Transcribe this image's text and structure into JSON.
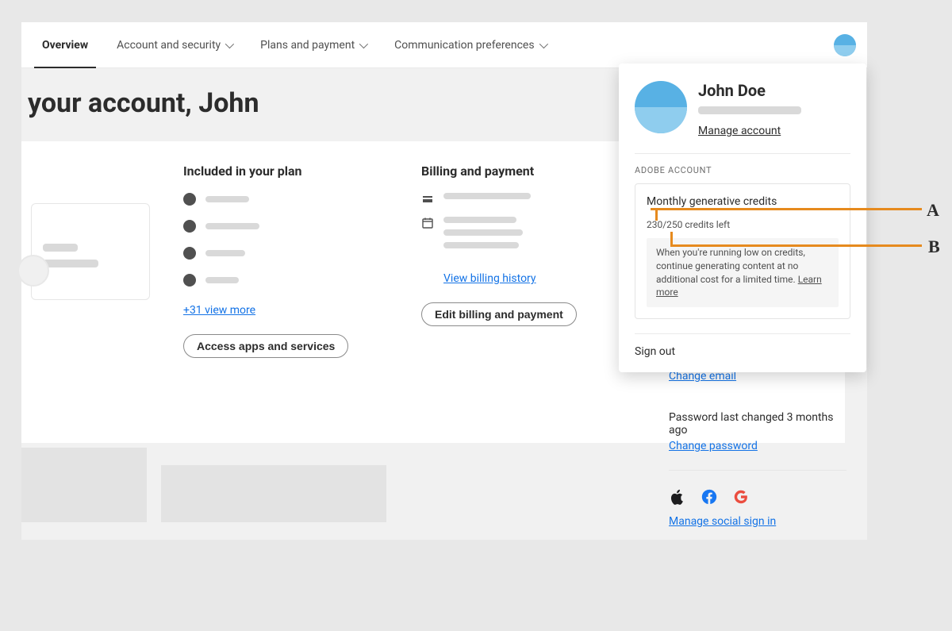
{
  "nav": {
    "overview": "Overview",
    "account_security": "Account and security",
    "plans_payment": "Plans and payment",
    "comm_prefs": "Communication preferences"
  },
  "page_title": "your account, John",
  "included": {
    "heading": "Included in your plan",
    "view_more": "+31 view more",
    "access_btn": "Access apps and services"
  },
  "billing": {
    "heading": "Billing and payment",
    "view_history": "View billing history",
    "edit_btn": "Edit billing and payment"
  },
  "security": {
    "change_email": "Change email",
    "password_line": "Password last changed 3 months ago",
    "change_password": "Change password",
    "manage_social": "Manage social sign in"
  },
  "popover": {
    "name": "John Doe",
    "manage": "Manage account",
    "section": "ADOBE ACCOUNT",
    "credits_title": "Monthly generative credits",
    "credits_left": "230/250 credits left",
    "note_text": "When you're running low on credits, continue generating content at no additional cost for a limited time. ",
    "learn_more": "Learn more",
    "sign_out": "Sign out"
  },
  "annotations": {
    "a": "A",
    "b": "B"
  }
}
